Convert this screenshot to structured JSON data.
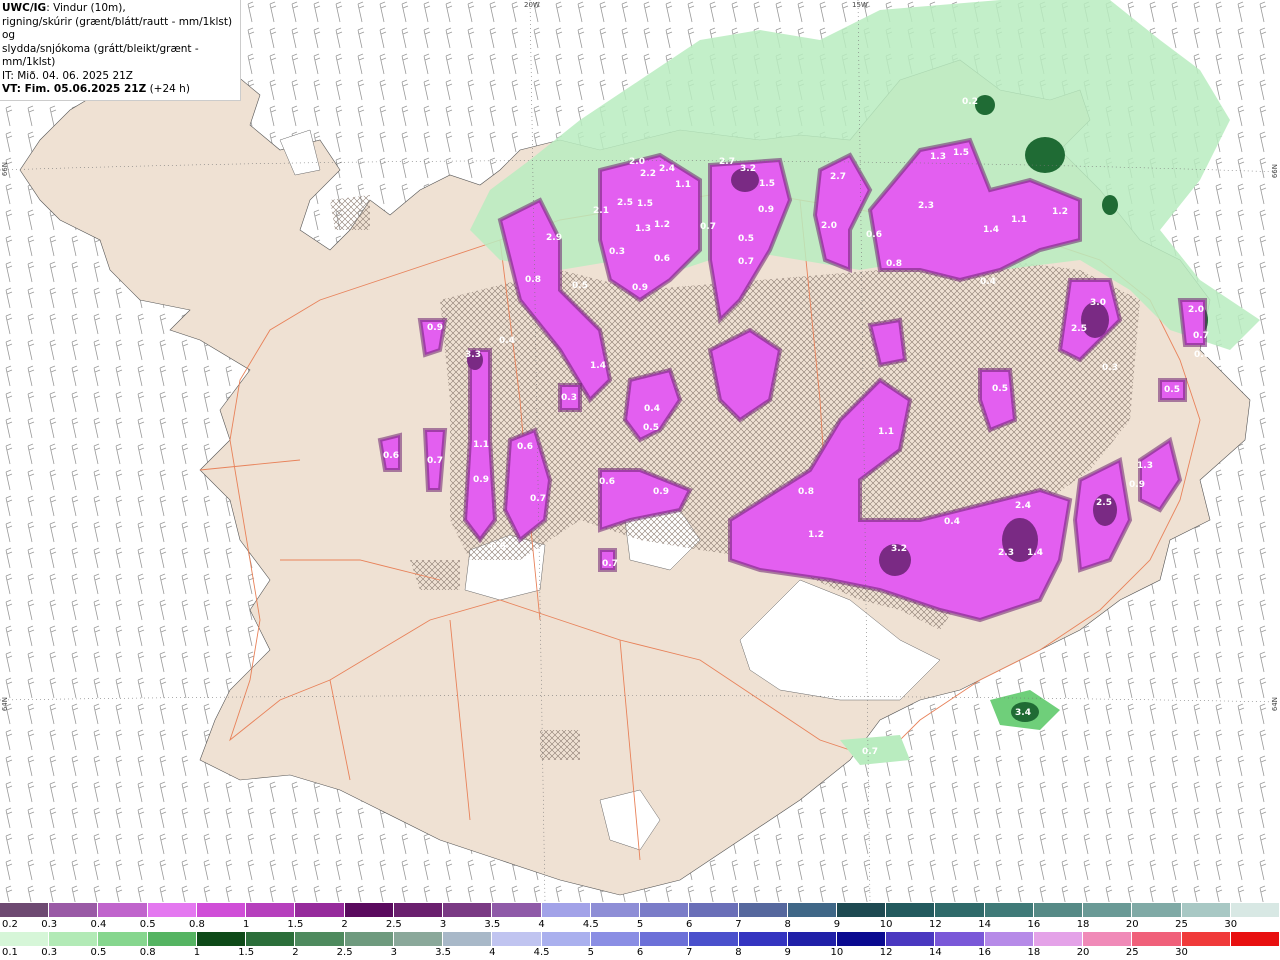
{
  "header": {
    "model": "UWC/IG",
    "line1_rest": ": Vindur (10m),",
    "line2": "rigning/skúrir (grænt/blátt/rautt - mm/1klst) og",
    "line3": "slydda/snjókoma (grátt/bleikt/grænt - mm/1klst)",
    "line4": "IT: Mið. 04. 06. 2025 21Z",
    "line5_bold": "VT: Fim. 05.06.2025 21Z",
    "line5_rest": " (+24 h)"
  },
  "coords": {
    "top_20w": "20W",
    "top_15w": "15W",
    "left_66n": "66N",
    "right_66n": "66N",
    "left_64n": "64N",
    "right_64n": "64N"
  },
  "colors": {
    "land": "#efe1d3",
    "sea": "#ffffff",
    "glacier": "#ffffff",
    "roads": "#e8825a",
    "rain_light": "#b9ecbf",
    "rain_mid": "#6fcf7a",
    "rain_dark": "#1f6b34",
    "snow_light": "#d98ae0",
    "snow_mid": "#e35ff0",
    "snow_dark": "#6b2070"
  },
  "legend_snow": {
    "labels": [
      "0.2",
      "0.3",
      "0.4",
      "0.5",
      "0.8",
      "1",
      "1.5",
      "2",
      "2.5",
      "3",
      "3.5",
      "4",
      "4.5",
      "5",
      "6",
      "7",
      "8",
      "9",
      "10",
      "12",
      "14",
      "16",
      "18",
      "20",
      "25",
      "30"
    ],
    "colors": [
      "#6e4a72",
      "#9a5aa6",
      "#c064cc",
      "#e478f0",
      "#d04ed8",
      "#b63fbd",
      "#962a9c",
      "#5a0a5e",
      "#6a1f6e",
      "#7a3a84",
      "#8f5aa8",
      "#a2a2e8",
      "#8e8ed6",
      "#7a7cc8",
      "#6a6fb8",
      "#56689e",
      "#3f6787",
      "#1e4a52",
      "#235a5e",
      "#2f6a6a",
      "#3f7a78",
      "#568a86",
      "#6a9a96",
      "#80aaa6",
      "#a8c8c4",
      "#d8e8e4"
    ]
  },
  "legend_rain": {
    "labels": [
      "0.1",
      "0.3",
      "0.5",
      "0.8",
      "1",
      "1.5",
      "2",
      "2.5",
      "3",
      "3.5",
      "4",
      "4.5",
      "5",
      "6",
      "7",
      "8",
      "9",
      "10",
      "12",
      "14",
      "16",
      "18",
      "20",
      "25",
      "30"
    ],
    "colors": [
      "#d6f6d8",
      "#b2eab6",
      "#86d68e",
      "#55b462",
      "#0e4a18",
      "#2b6e3a",
      "#4e8a5e",
      "#6e9a7e",
      "#8aa89a",
      "#a8b8c8",
      "#c0c4f0",
      "#aab0ee",
      "#8a8ee4",
      "#6c70d8",
      "#4a50cc",
      "#3434c0",
      "#2020a8",
      "#0a0a90",
      "#4a38c0",
      "#7a58d8",
      "#b68ae8",
      "#e4a2e8",
      "#f08ab8",
      "#f0607a",
      "#f03a3a",
      "#e81010"
    ]
  },
  "precip_labels": [
    "0.9",
    "3.3",
    "0.4",
    "0.6",
    "0.7",
    "1.1",
    "0.9",
    "0.6",
    "0.7",
    "0.5",
    "0.3",
    "2.9",
    "0.8",
    "0.5",
    "1.4",
    "2.1",
    "2.5",
    "1.5",
    "1.3",
    "0.6",
    "0.9",
    "2.0",
    "2.2",
    "2.4",
    "1.1",
    "2.7",
    "0.3",
    "1.2",
    "3.2",
    "1.5",
    "0.9",
    "0.5",
    "0.7",
    "2.7",
    "2.0",
    "0.6",
    "1.3",
    "1.5",
    "2.3",
    "1.1",
    "1.2",
    "1.4",
    "0.4",
    "3.0",
    "2.5",
    "0.3",
    "2.0",
    "0.7",
    "0.6",
    "0.5",
    "1.3",
    "0.9",
    "2.5",
    "2.4",
    "2.3",
    "1.4",
    "3.2",
    "1.2",
    "0.8",
    "0.4",
    "0.6",
    "0.9",
    "0.7",
    "0.4",
    "0.5",
    "1.1",
    "0.2",
    "0.5",
    "0.8",
    "0.7",
    "3.4",
    "0.7"
  ]
}
